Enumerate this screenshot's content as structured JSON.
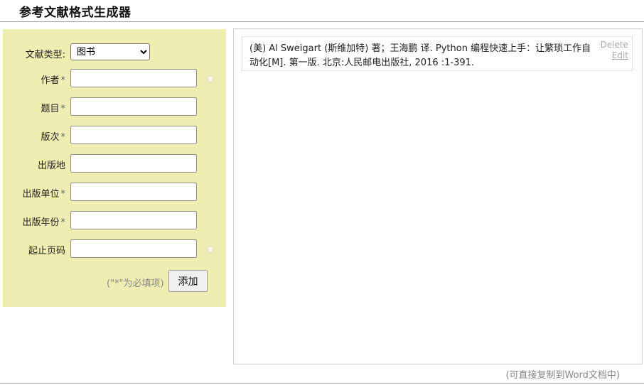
{
  "header": {
    "title": "参考文献格式生成器"
  },
  "form": {
    "type_label": "文献类型:",
    "type_selected": "图书",
    "fields": [
      {
        "label": "作者",
        "required": true,
        "value": ""
      },
      {
        "label": "题目",
        "required": true,
        "value": ""
      },
      {
        "label": "版次",
        "required": true,
        "value": ""
      },
      {
        "label": "出版地",
        "required": false,
        "value": ""
      },
      {
        "label": "出版单位",
        "required": true,
        "value": ""
      },
      {
        "label": "出版年份",
        "required": true,
        "value": ""
      },
      {
        "label": "起止页码",
        "required": false,
        "value": ""
      }
    ],
    "required_mark": "*",
    "hint": "(\"*\"为必填项)",
    "add_label": "添加"
  },
  "references": [
    {
      "text": "(美) Al Sweigart (斯维加特) 著；王海鹏 译. Python 编程快速上手：让繁琐工作自动化[M]. 第一版. 北京:人民邮电出版社, 2016 :1-391.",
      "delete_label": "Delete",
      "edit_label": "Edit"
    }
  ],
  "footer": {
    "note": "(可直接复制到Word文档中)"
  },
  "colors": {
    "form_bg": "#eeeeb3",
    "border": "#cfcfcf"
  }
}
